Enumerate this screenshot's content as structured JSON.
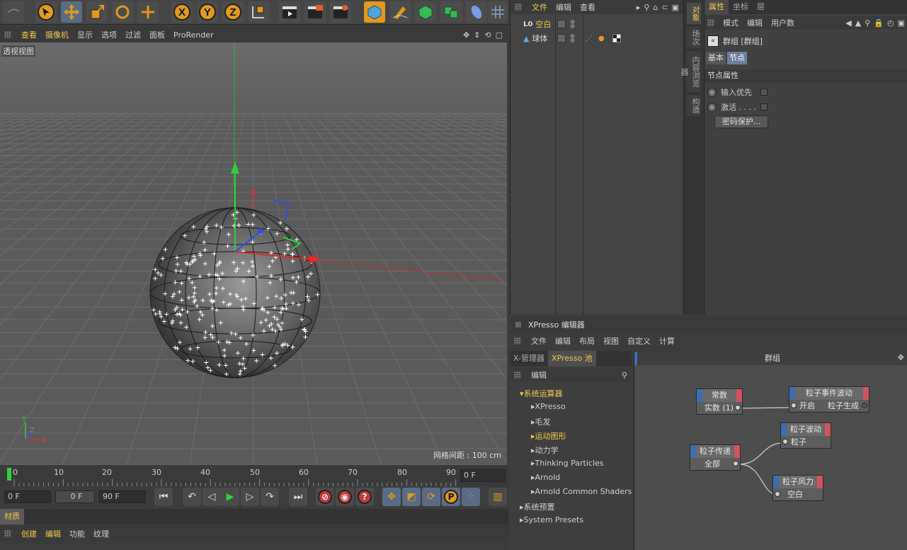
{
  "colors": {
    "accent": "#f0c850",
    "selection": "#5a6b86",
    "node_in": "#3c6fb0",
    "node_out": "#d0545e"
  },
  "toolbar": {
    "axis_x": "X",
    "axis_y": "Y",
    "axis_z": "Z"
  },
  "viewport": {
    "menu": [
      "查看",
      "摄像机",
      "显示",
      "选项",
      "过滤",
      "面板",
      "ProRender"
    ],
    "label": "透视视图",
    "grid_spacing": "网格间距 : 100 cm",
    "axis_y": "Y",
    "axis_z": "Z",
    "axis_x": "X"
  },
  "timeline": {
    "ticks": [
      "0",
      "10",
      "20",
      "30",
      "40",
      "50",
      "60",
      "70",
      "80",
      "90"
    ],
    "current_frame": "0 F"
  },
  "transport": {
    "start": "0 F",
    "preview_start": "0 F",
    "end": "90 F"
  },
  "material": {
    "tab": "材质",
    "menu": [
      "创建",
      "编辑",
      "功能",
      "纹理"
    ]
  },
  "object_manager": {
    "menu": [
      "文件",
      "编辑",
      "查看"
    ],
    "objects": [
      {
        "name": "空白",
        "prefix": "L0"
      },
      {
        "name": "球体"
      }
    ]
  },
  "side_tabs": [
    "对象",
    "场次",
    "内容浏览器",
    "构造"
  ],
  "attributes": {
    "tabs": [
      "属性",
      "坐标",
      "层"
    ],
    "menu": [
      "模式",
      "编辑",
      "用户数"
    ],
    "title": "群组 [群组]",
    "subtabs": [
      "基本",
      "节点"
    ],
    "section": "节点属性",
    "fields": [
      "输入优先",
      "激活 . . . ."
    ],
    "password_button": "密码保护..."
  },
  "xpresso": {
    "title": "XPresso 编辑器",
    "menu": [
      "文件",
      "编辑",
      "布局",
      "视图",
      "自定义",
      "计算"
    ],
    "left_tabs": [
      "X-管理器",
      "XPresso 池"
    ],
    "left_menu": "编辑",
    "tree": [
      "系统运算器",
      "XPresso",
      "毛发",
      "运动图形",
      "动力学",
      "Thinking Particles",
      "Arnold",
      "Arnold Common Shaders",
      "系统预置",
      "System Presets"
    ],
    "canvas_title": "群组",
    "nodes": {
      "const": {
        "title": "常数",
        "out": "实数 (1)"
      },
      "event": {
        "title": "粒子事件波动",
        "in": "开启",
        "out": "粒子生成"
      },
      "wave": {
        "title": "粒子波动",
        "in": "粒子"
      },
      "pass": {
        "title": "粒子传递",
        "out": "全部"
      },
      "wind": {
        "title": "粒子风力",
        "in": "空白"
      }
    }
  }
}
